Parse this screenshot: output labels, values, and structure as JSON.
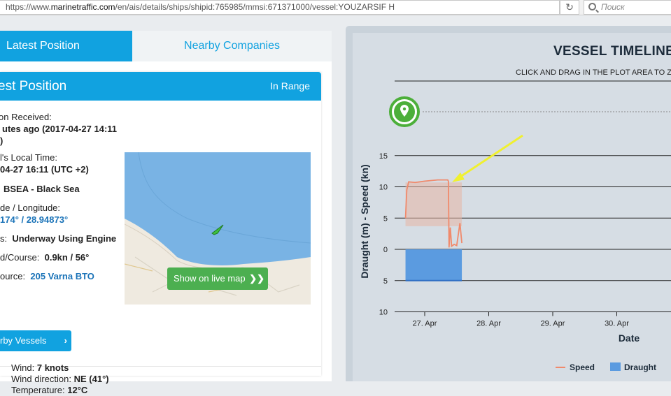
{
  "browser": {
    "url_prefix": "https://www.",
    "url_domain": "marinetraffic.com",
    "url_path": "/en/ais/details/ships/shipid:765985/mmsi:671371000/vessel:YOUZARSIF H",
    "search_placeholder": "Поиск"
  },
  "tabs": {
    "active": "Latest Position",
    "other": "Nearby Companies"
  },
  "card": {
    "title": "est Position",
    "range": "In Range",
    "received_label": "on Received:",
    "received_value_1": "utes ago (2017-04-27 14:11",
    "received_value_2": ")",
    "local_time_label": "l's Local Time:",
    "local_time_value": "04-27 16:11 (UTC +2)",
    "area_value": "BSEA - Black Sea",
    "latlon_label": "de / Longitude:",
    "latlon_value": "174° / 28.94873°",
    "status_label": "s:",
    "status_value": "Underway Using Engine",
    "speed_label": "d/Course:",
    "speed_value": "0.9kn / 56°",
    "source_label": "ource:",
    "source_value": "205 Varna BTO",
    "nearby_button": "rby Vessels",
    "live_map_button": "Show on live map"
  },
  "weather": {
    "wind_label": "Wind:",
    "wind_value": "7  knots",
    "direction_label": "Wind direction:",
    "direction_value": "NE (41°)",
    "temp_label": "Temperature:",
    "temp_value": "12°C"
  },
  "timeline": {
    "title": "VESSEL TIMELINE",
    "subtitle": "CLICK AND DRAG IN THE PLOT AREA TO Z"
  },
  "chart_data": {
    "type": "area",
    "ylabel": "Draught (m) - Speed (kn)",
    "xlabel": "Date",
    "x_ticks": [
      "27. Apr",
      "28. Apr",
      "29. Apr",
      "30. Apr"
    ],
    "y_ticks_speed": [
      15,
      10,
      5,
      0
    ],
    "y_ticks_draught": [
      5,
      10
    ],
    "series": [
      {
        "name": "Speed",
        "color": "#f08a6c",
        "unit": "kn",
        "points": [
          [
            26.7,
            5.0
          ],
          [
            26.72,
            9.5
          ],
          [
            26.75,
            10.8
          ],
          [
            26.85,
            10.7
          ],
          [
            27.0,
            10.9
          ],
          [
            27.2,
            11.1
          ],
          [
            27.36,
            11.1
          ],
          [
            27.37,
            10.9
          ],
          [
            27.38,
            0.3
          ],
          [
            27.4,
            3.5
          ],
          [
            27.42,
            0.5
          ],
          [
            27.46,
            0.8
          ],
          [
            27.5,
            0.6
          ],
          [
            27.55,
            4.2
          ],
          [
            27.58,
            1.0
          ]
        ],
        "band": [
          26.7,
          27.58,
          3.7,
          10.7
        ]
      },
      {
        "name": "Draught",
        "color": "#5b9be0",
        "unit": "m",
        "from": 26.7,
        "to": 27.58,
        "value": 5.0
      }
    ],
    "legend": "bottom-right"
  },
  "icons": {
    "map_pin": "location-pin-icon",
    "ship": "ship-marker-icon",
    "chevron": "chevron-right-icon"
  }
}
